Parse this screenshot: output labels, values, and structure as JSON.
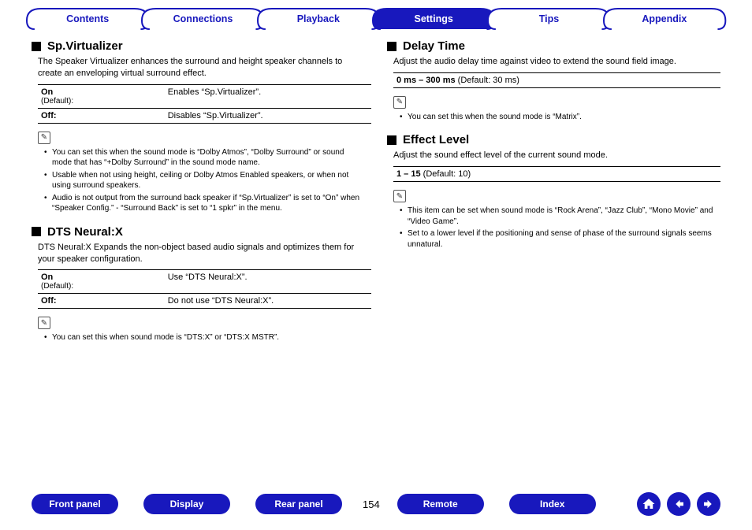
{
  "tabs": [
    "Contents",
    "Connections",
    "Playback",
    "Settings",
    "Tips",
    "Appendix"
  ],
  "active_tab": 3,
  "page_number": "154",
  "left": {
    "s1": {
      "title": "Sp.Virtualizer",
      "desc": "The Speaker Virtualizer enhances the surround and height speaker channels to create an enveloping virtual surround effect.",
      "rows": [
        {
          "k": "On",
          "sub": "(Default):",
          "v": "Enables “Sp.Virtualizer”."
        },
        {
          "k": "Off:",
          "sub": "",
          "v": "Disables “Sp.Virtualizer”."
        }
      ],
      "notes": [
        "You can set this when the sound mode is “Dolby Atmos”, “Dolby Surround” or sound mode that has “+Dolby Surround” in the sound mode name.",
        "Usable when not using height, ceiling or Dolby Atmos Enabled speakers, or when not using surround speakers.",
        "Audio is not output from the surround back speaker if “Sp.Virtualizer” is set to “On” when “Speaker Config.” - “Surround Back” is set to “1 spkr” in the menu."
      ]
    },
    "s2": {
      "title": "DTS Neural:X",
      "desc": "DTS Neural:X Expands the non-object based audio signals and optimizes them for your speaker configuration.",
      "rows": [
        {
          "k": "On",
          "sub": "(Default):",
          "v": "Use “DTS Neural:X”."
        },
        {
          "k": "Off:",
          "sub": "",
          "v": "Do not use “DTS Neural:X”."
        }
      ],
      "notes": [
        "You can set this when sound mode is “DTS:X” or “DTS:X MSTR”."
      ]
    }
  },
  "right": {
    "s1": {
      "title": "Delay Time",
      "desc": "Adjust the audio delay time against video to extend the sound field image.",
      "range_bold": "0 ms – 300 ms",
      "range_rest": " (Default: 30 ms)",
      "notes": [
        "You can set this when the sound mode is “Matrix”."
      ]
    },
    "s2": {
      "title": "Effect Level",
      "desc": "Adjust the sound effect level of the current sound mode.",
      "range_bold": "1 – 15",
      "range_rest": " (Default: 10)",
      "notes": [
        "This item can be set when sound mode is “Rock Arena”, “Jazz Club”, “Mono Movie” and “Video Game”.",
        "Set to a lower level if the positioning and sense of phase of the surround signals seems unnatural."
      ]
    }
  },
  "bottom_links": [
    "Front panel",
    "Display",
    "Rear panel",
    "Remote",
    "Index"
  ]
}
